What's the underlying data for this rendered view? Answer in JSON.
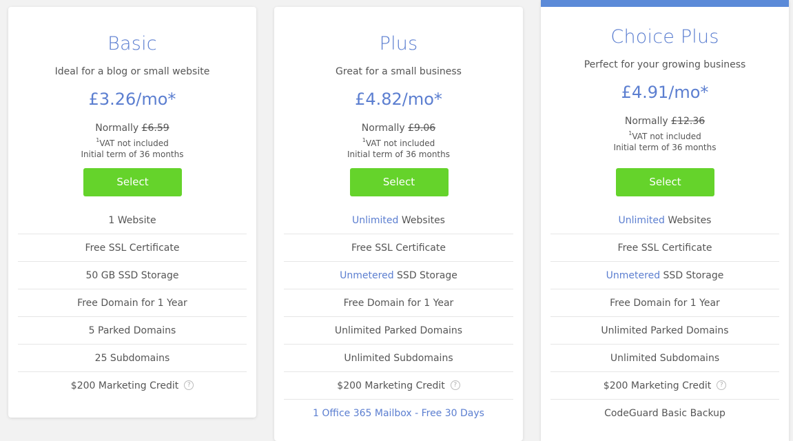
{
  "plans": [
    {
      "name": "Basic",
      "tagline": "Ideal for a blog or small website",
      "price": "£3.26/mo*",
      "normally_label": "Normally",
      "normally_price": "£6.59",
      "vat_sup": "1",
      "vat_text": "VAT not included",
      "term": "Initial term of 36 months",
      "select_label": "Select",
      "features": [
        {
          "hl": "",
          "text": "1 Website"
        },
        {
          "hl": "",
          "text": "Free SSL Certificate"
        },
        {
          "hl": "",
          "text": "50 GB SSD Storage"
        },
        {
          "hl": "",
          "text": "Free Domain for 1 Year"
        },
        {
          "hl": "",
          "text": "5 Parked Domains"
        },
        {
          "hl": "",
          "text": "25 Subdomains"
        },
        {
          "hl": "",
          "text": "$200 Marketing Credit",
          "help": "?"
        }
      ]
    },
    {
      "name": "Plus",
      "tagline": "Great for a small business",
      "price": "£4.82/mo*",
      "normally_label": "Normally",
      "normally_price": "£9.06",
      "vat_sup": "1",
      "vat_text": "VAT not included",
      "term": "Initial term of 36 months",
      "select_label": "Select",
      "features": [
        {
          "hl": "Unlimited",
          "text": " Websites"
        },
        {
          "hl": "",
          "text": "Free SSL Certificate"
        },
        {
          "hl": "Unmetered",
          "text": " SSD Storage"
        },
        {
          "hl": "",
          "text": "Free Domain for 1 Year"
        },
        {
          "hl": "",
          "text": "Unlimited Parked Domains"
        },
        {
          "hl": "",
          "text": "Unlimited Subdomains"
        },
        {
          "hl": "",
          "text": "$200 Marketing Credit",
          "help": "?"
        },
        {
          "hl": "",
          "text": "1 Office 365 Mailbox - Free 30 Days",
          "link": true
        }
      ]
    },
    {
      "name": "Choice Plus",
      "tagline": "Perfect for your growing business",
      "price": "£4.91/mo*",
      "normally_label": "Normally",
      "normally_price": "£12.36",
      "vat_sup": "1",
      "vat_text": "VAT not included",
      "term": "Initial term of 36 months",
      "select_label": "Select",
      "features": [
        {
          "hl": "Unlimited",
          "text": " Websites"
        },
        {
          "hl": "",
          "text": "Free SSL Certificate"
        },
        {
          "hl": "Unmetered",
          "text": " SSD Storage"
        },
        {
          "hl": "",
          "text": "Free Domain for 1 Year"
        },
        {
          "hl": "",
          "text": "Unlimited Parked Domains"
        },
        {
          "hl": "",
          "text": "Unlimited Subdomains"
        },
        {
          "hl": "",
          "text": "$200 Marketing Credit",
          "help": "?"
        },
        {
          "hl": "",
          "text": "CodeGuard Basic Backup"
        }
      ]
    }
  ],
  "colors": {
    "accent_blue": "#5b7ed0",
    "select_green": "#65d32b",
    "featured_bar": "#5b8ad8"
  }
}
